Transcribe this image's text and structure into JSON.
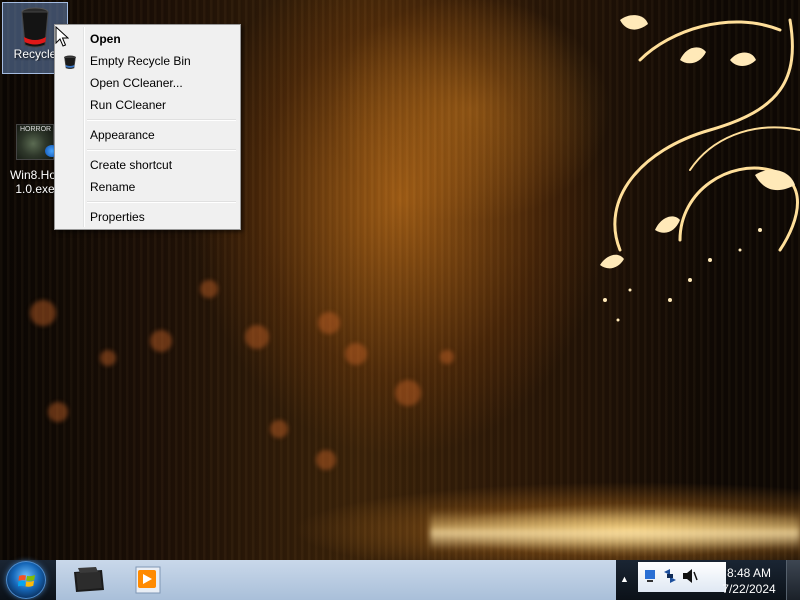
{
  "desktop": {
    "icons": [
      {
        "label": "Recycle",
        "icon": "recycle-bin-icon"
      },
      {
        "label": "Win8.Hor",
        "label_line2": "1.0.exe",
        "icon": "horror-game-icon",
        "thumb_text": "HORROR"
      }
    ]
  },
  "context_menu": {
    "items": [
      {
        "label": "Open",
        "bold": true
      },
      {
        "label": "Empty Recycle Bin",
        "icon": "recycle-bin-icon"
      },
      {
        "label": "Open CCleaner..."
      },
      {
        "label": "Run CCleaner"
      },
      {
        "label": "Appearance"
      },
      {
        "label": "Create shortcut"
      },
      {
        "label": "Rename"
      },
      {
        "label": "Properties"
      }
    ]
  },
  "taskbar": {
    "start_icon": "windows-logo-icon",
    "pinned": [
      {
        "name": "file-explorer-icon"
      },
      {
        "name": "media-player-icon"
      }
    ],
    "tray": {
      "overflow_icon": "chevron-up-icon",
      "icons": [
        "network-icon",
        "connection-icon",
        "volume-icon"
      ],
      "time": "8:48 AM",
      "date": "7/22/2024"
    }
  },
  "colors": {
    "menu_bg": "#f0f0f0",
    "taskbar_strip": "#b9cce3",
    "wallpaper_glow": "#d9a04a"
  }
}
